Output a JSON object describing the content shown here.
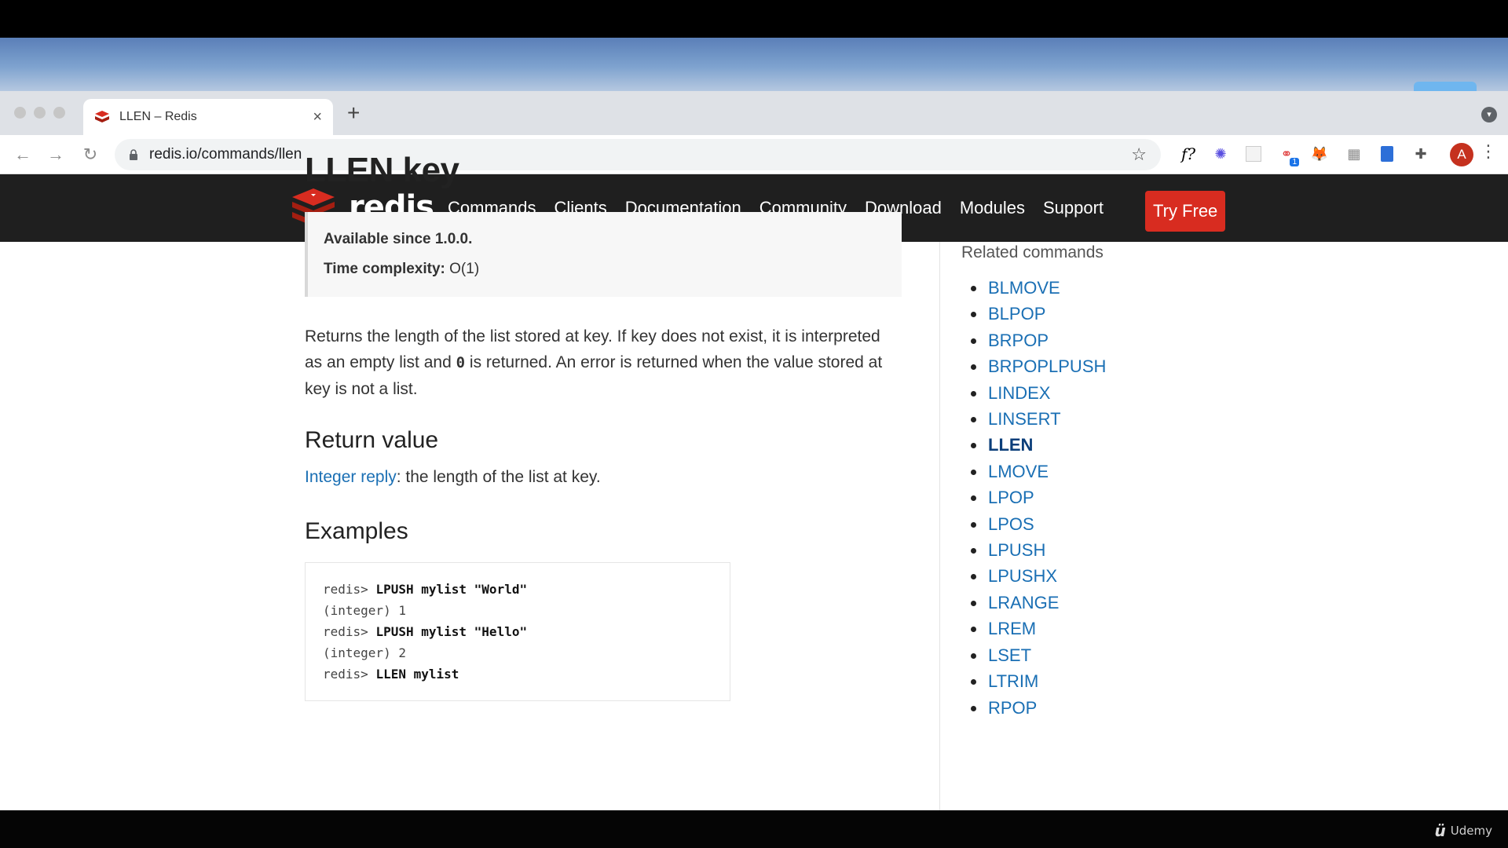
{
  "browser": {
    "tab_title": "LLEN – Redis",
    "new_tab": "+",
    "tab_close": "×",
    "url": "redis.io/commands/llen",
    "profile_initial": "A",
    "extension_label": "f?",
    "extension_badge": "1"
  },
  "site": {
    "brand": "redis",
    "nav": [
      "Commands",
      "Clients",
      "Documentation",
      "Community",
      "Download",
      "Modules",
      "Support"
    ],
    "cta": "Try Free",
    "accent": "#d82c20",
    "header_bg": "#1f1f1f",
    "link_color": "#1a6fb4"
  },
  "page": {
    "title": "LLEN key",
    "available_label": "Available since 1.0.0.",
    "complexity_label": "Time complexity:",
    "complexity_value": "O(1)",
    "description": {
      "p1": "Returns the length of the list stored at ",
      "key1": "key",
      "p2": ". If ",
      "key2": "key",
      "p3": " does not exist, it is interpreted as an empty list and ",
      "zero": "0",
      "p4": " is returned. An error is returned when the value stored at ",
      "key3": "key",
      "p5": " is not a list."
    },
    "return_heading": "Return value",
    "return_link": "Integer reply",
    "return_text": ": the length of the list at ",
    "return_key": "key",
    "return_end": ".",
    "examples_heading": "Examples",
    "examples": [
      {
        "prompt": "redis> ",
        "cmd": "LPUSH mylist \"World\""
      },
      {
        "output": "(integer) 1"
      },
      {
        "prompt": "redis> ",
        "cmd": "LPUSH mylist \"Hello\""
      },
      {
        "output": "(integer) 2"
      },
      {
        "prompt": "redis> ",
        "cmd": "LLEN mylist"
      }
    ]
  },
  "related": {
    "heading": "Related commands",
    "items": [
      "BLMOVE",
      "BLPOP",
      "BRPOP",
      "BRPOPLPUSH",
      "LINDEX",
      "LINSERT",
      "LLEN",
      "LMOVE",
      "LPOP",
      "LPOS",
      "LPUSH",
      "LPUSHX",
      "LRANGE",
      "LREM",
      "LSET",
      "LTRIM",
      "RPOP"
    ],
    "current": "LLEN"
  },
  "watermark": "Udemy"
}
